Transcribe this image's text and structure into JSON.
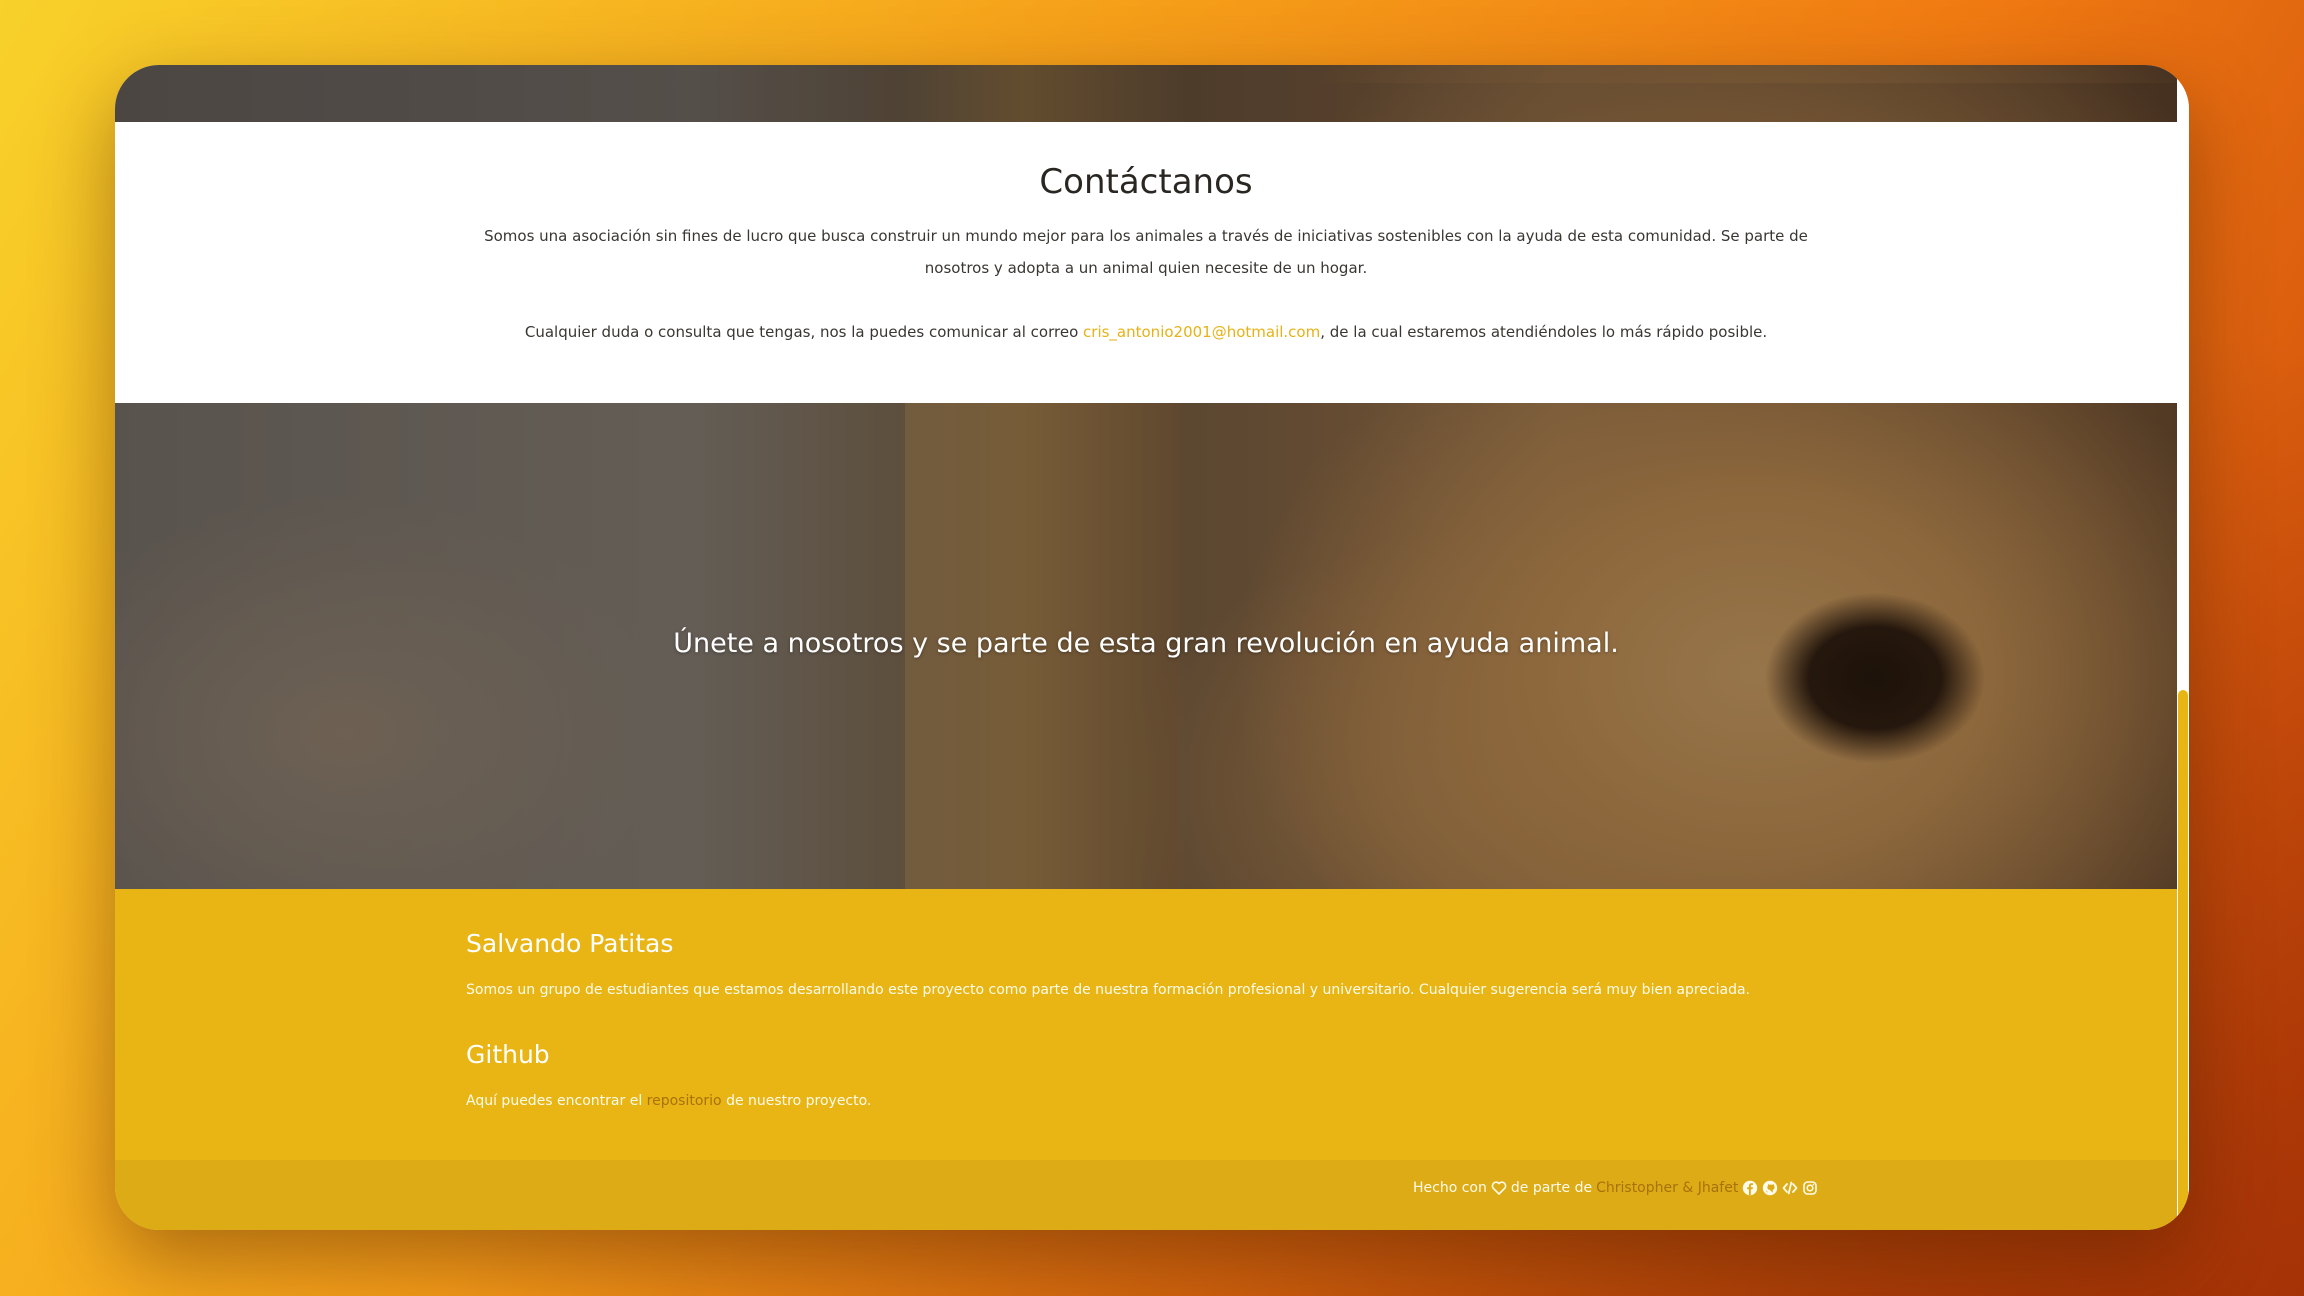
{
  "contact": {
    "title": "Contáctanos",
    "paragraph1": "Somos una asociación sin fines de lucro que busca construir un mundo mejor para los animales a través de iniciativas sostenibles con la ayuda de esta comunidad. Se parte de nosotros y adopta a un animal quien necesite de un hogar.",
    "paragraph2_before": "Cualquier duda o consulta que tengas, nos la puedes comunicar al correo ",
    "email": "cris_antonio2001@hotmail.com",
    "paragraph2_after": ", de la cual estaremos atendiéndoles lo más rápido posible."
  },
  "hero": {
    "headline": "Únete a nosotros y se parte de esta gran revolución en ayuda animal."
  },
  "footer": {
    "about_title": "Salvando Patitas",
    "about_text": "Somos un grupo de estudiantes que estamos desarrollando este proyecto como parte de nuestra formación profesional y universitario. Cualquier sugerencia será muy bien apreciada.",
    "github_title": "Github",
    "github_before": "Aquí puedes encontrar el ",
    "github_link": "repositorio",
    "github_after": " de nuestro proyecto.",
    "credits_before": "Hecho con",
    "credits_middle": "de parte de",
    "credits_authors": "Christopher & Jhafet",
    "icons": [
      "heart-icon",
      "facebook-icon",
      "github-icon",
      "code-icon",
      "instagram-icon"
    ]
  },
  "colors": {
    "accent": "#e8b514",
    "footer_bottom": "#dcab16",
    "link": "#e6b216",
    "link_dark": "#a8710b"
  }
}
